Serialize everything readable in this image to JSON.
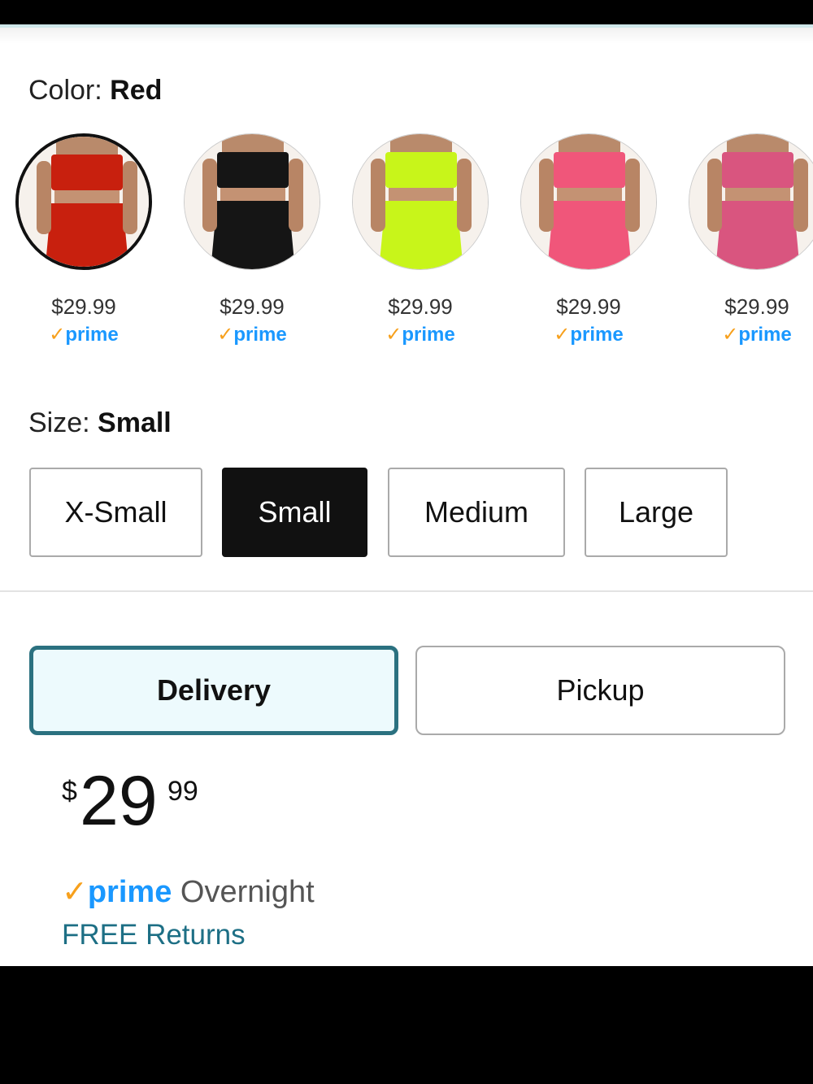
{
  "color_section": {
    "label": "Color: ",
    "value": "Red"
  },
  "swatches": [
    {
      "name": "Red",
      "price": "$29.99",
      "prime": "prime",
      "color": "#c8200e"
    },
    {
      "name": "Black",
      "price": "$29.99",
      "prime": "prime",
      "color": "#151515"
    },
    {
      "name": "Neon Green",
      "price": "$29.99",
      "prime": "prime",
      "color": "#c8f51a"
    },
    {
      "name": "Pink",
      "price": "$29.99",
      "prime": "prime",
      "color": "#f0567a"
    },
    {
      "name": "Rose",
      "price": "$29.99",
      "prime": "prime",
      "color": "#d9557f"
    }
  ],
  "size_section": {
    "label": "Size: ",
    "value": "Small"
  },
  "sizes": [
    "X-Small",
    "Small",
    "Medium",
    "Large"
  ],
  "fulfillment": {
    "delivery": "Delivery",
    "pickup": "Pickup"
  },
  "price": {
    "symbol": "$",
    "whole": "29",
    "fraction": "99"
  },
  "shipping": {
    "check": "✓",
    "prime": "prime",
    "speed": "Overnight",
    "returns": "FREE Returns"
  },
  "colors": {
    "prime_blue": "#1a98ff",
    "check_orange": "#f7a01c",
    "selected_border": "#2b7180",
    "link": "#1d6f85"
  }
}
